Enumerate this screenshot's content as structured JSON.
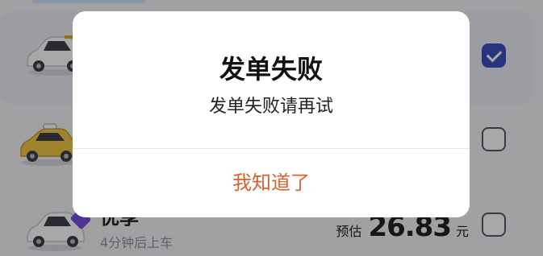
{
  "list": {
    "items": [
      {
        "name": "",
        "selected": true
      },
      {
        "name": "",
        "selected": false
      },
      {
        "name": "优享",
        "eta": "4分钟后上车",
        "price_label": "预估",
        "price": "26.83",
        "unit": "元",
        "selected": false
      }
    ]
  },
  "dialog": {
    "title": "发单失败",
    "message": "发单失败请再试",
    "confirm_label": "我知道了"
  },
  "colors": {
    "accent": "#d6632f",
    "checkbox_on": "#3a4fbf",
    "scrim": "rgba(0,0,0,0.34)"
  }
}
